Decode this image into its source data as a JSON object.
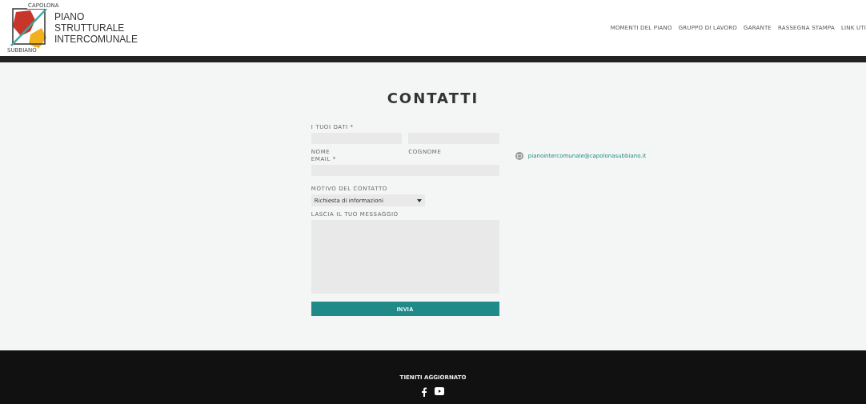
{
  "header": {
    "logo": {
      "top_text": "CAPOLONA",
      "bottom_text": "SUBBIANO",
      "title_lines": [
        "PIANO",
        "STRUTTURALE",
        "INTERCOMUNALE"
      ]
    },
    "nav": [
      "MOMENTI DEL PIANO",
      "GRUPPO DI LAVORO",
      "GARANTE",
      "RASSEGNA STAMPA",
      "LINK UTI"
    ]
  },
  "page_title": "CONTATTI",
  "form": {
    "group_label": "I TUOI DATI *",
    "first_name_label": "NOME",
    "last_name_label": "COGNOME",
    "email_label": "EMAIL *",
    "reason_label": "MOTIVO DEL CONTATTO",
    "reason_value": "Richiesta di informazioni",
    "message_label": "LASCIA IL TUO MESSAGGIO",
    "submit": "INVIA"
  },
  "contact_email": "pianointercomunale@capolonasubbiano.it",
  "footer": {
    "title": "TIENITI AGGIORNATO"
  }
}
